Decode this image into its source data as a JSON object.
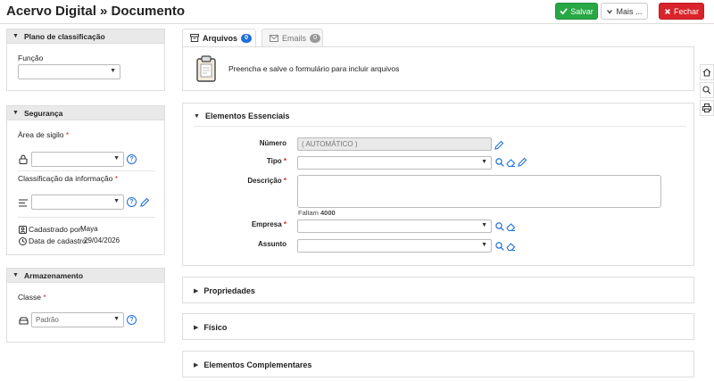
{
  "header": {
    "title": "Acervo Digital » Documento",
    "save_label": "Salvar",
    "more_label": "Mais ...",
    "close_label": "Fechar"
  },
  "panels": {
    "plano": {
      "title": "Plano de classificação",
      "funcao_label": "Função"
    },
    "seguranca": {
      "title": "Segurança",
      "area_label": "Área de sigilo",
      "classif_label": "Classificação da informação",
      "cadastrado_label": "Cadastrado por:",
      "cadastrado_value": "Maya",
      "data_label": "Data de cadastro:",
      "data_value": "29/04/2026"
    },
    "armazenamento": {
      "title": "Armazenamento",
      "classe_label": "Classe",
      "classe_value": "Padrão"
    }
  },
  "tabs": [
    {
      "label": "Arquivos",
      "count": "0"
    },
    {
      "label": "Emails",
      "count": "0"
    }
  ],
  "arquivos": {
    "message": "Preencha e salve o formulário para incluir arquivos"
  },
  "essenciais": {
    "title": "Elementos Essenciais",
    "numero_label": "Número",
    "numero_value": "( AUTOMÁTICO )",
    "tipo_label": "Tipo",
    "descricao_label": "Descrição",
    "faltam_label": "Faltam",
    "faltam_value": "4000",
    "empresa_label": "Empresa",
    "assunto_label": "Assunto",
    "required_mark": "*"
  },
  "sections": {
    "propriedades": "Propriedades",
    "fisico": "Físico",
    "complementares": "Elementos Complementares"
  },
  "colors": {
    "save": "#28a745",
    "close": "#d9242b",
    "accent": "#1e6fd9"
  }
}
